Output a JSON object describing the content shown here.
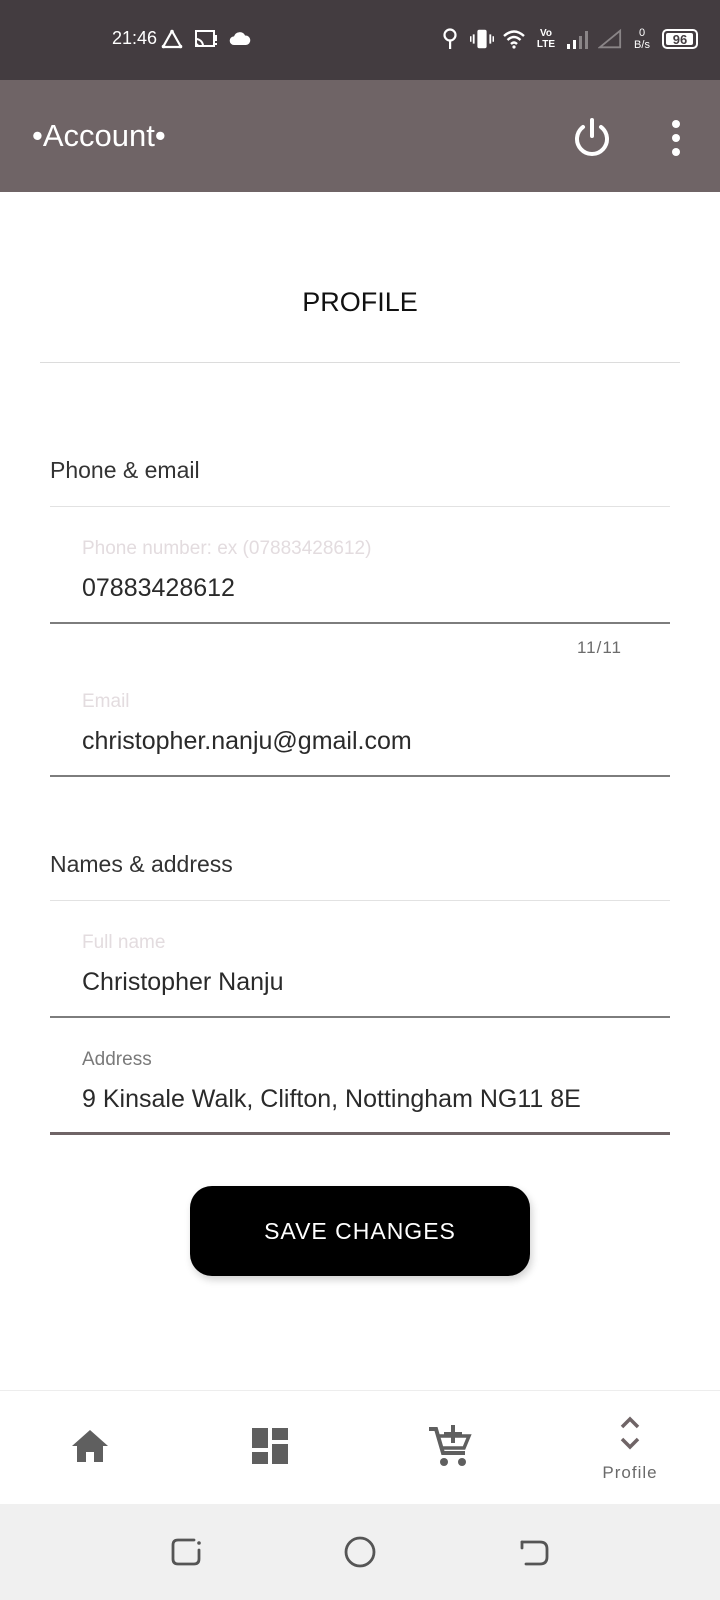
{
  "status_bar": {
    "time": "21:46",
    "left_icons": [
      "warning-triangle-icon",
      "screen-cast-icon",
      "cloud-icon"
    ],
    "right_icons": [
      "location-pin-icon",
      "vibrate-icon",
      "wifi-icon",
      "volte-icon",
      "signal-icon",
      "no-signal-icon"
    ],
    "volte_top": "Vo",
    "volte_bottom": "LTE",
    "net_speed_value": "0",
    "net_speed_unit": "B/s",
    "battery": "96",
    "battery_level": 0.96
  },
  "app_bar": {
    "title": "•Account•",
    "power_icon": "power-icon",
    "more_icon": "more-vert-icon",
    "background": "#6f6466"
  },
  "page": {
    "title": "PROFILE"
  },
  "phone_email": {
    "label": "Phone & email",
    "phone": {
      "label": "Phone number: ex (07883428612)",
      "value": "07883428612",
      "counter": "11/11"
    },
    "email": {
      "label": "Email",
      "value": "christopher.nanju@gmail.com"
    }
  },
  "names_address": {
    "label": "Names & address",
    "full_name": {
      "label": "Full name",
      "value": "Christopher Nanju"
    },
    "address": {
      "label": "Address",
      "value": "9 Kinsale Walk, Clifton, Nottingham NG11 8E"
    }
  },
  "save_button": {
    "label": "SAVE CHANGES"
  },
  "bottom_nav": {
    "items": [
      {
        "icon": "home-icon",
        "label": ""
      },
      {
        "icon": "dashboard-icon",
        "label": ""
      },
      {
        "icon": "add-to-cart-icon",
        "label": ""
      },
      {
        "icon": "unfold-icon",
        "label": "Profile"
      }
    ]
  },
  "system_nav": {
    "icons": [
      "recent-apps-icon",
      "home-circle-icon",
      "back-icon"
    ]
  }
}
